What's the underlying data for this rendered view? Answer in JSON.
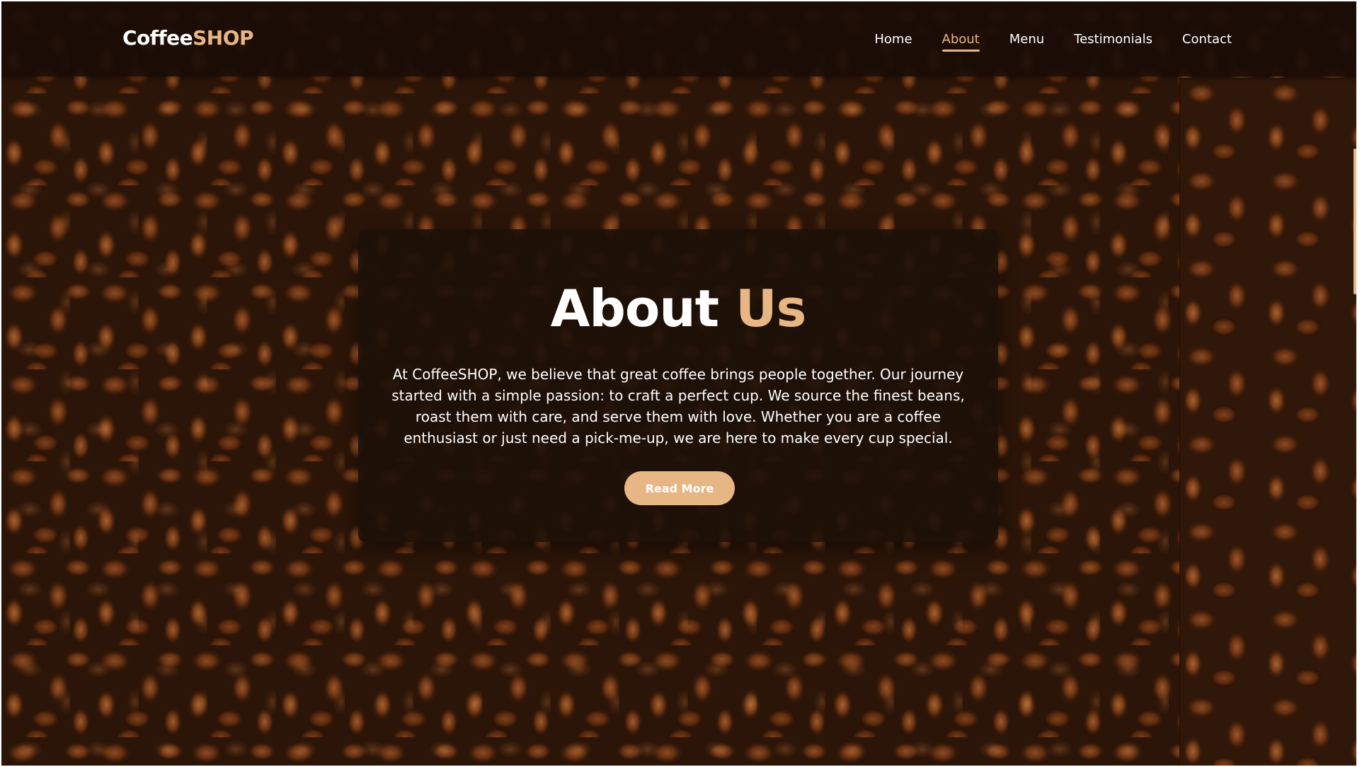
{
  "brand": {
    "name_main": "Coffee",
    "name_accent": "SHOP"
  },
  "nav": {
    "items": [
      {
        "label": "Home",
        "active": false
      },
      {
        "label": "About",
        "active": true
      },
      {
        "label": "Menu",
        "active": false
      },
      {
        "label": "Testimonials",
        "active": false
      },
      {
        "label": "Contact",
        "active": false
      }
    ]
  },
  "about": {
    "title_main": "About",
    "title_accent": "Us",
    "body": "At CoffeeSHOP, we believe that great coffee brings people together. Our journey started with a simple passion: to craft a perfect cup. We source the finest beans, roast them with care, and serve them with love. Whether you are a coffee enthusiast or just need a pick-me-up, we are here to make every cup special.",
    "button_label": "Read More"
  },
  "colors": {
    "accent": "#e7b685",
    "navbar_bg": "#1a0d06",
    "card_bg": "#1c0f08",
    "text": "#ffffff"
  },
  "icons": {
    "background": "coffee-beans-image"
  }
}
